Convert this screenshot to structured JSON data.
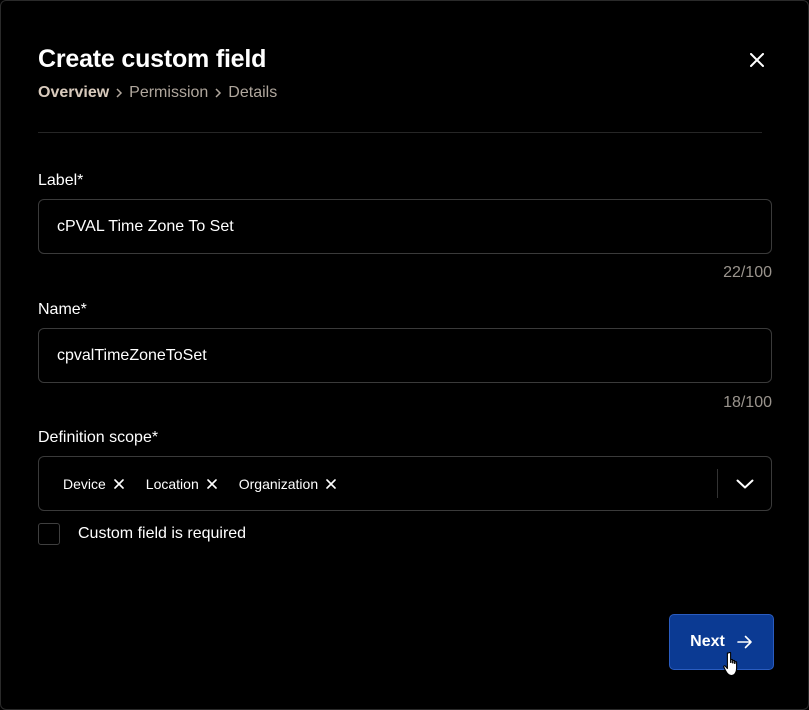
{
  "dialog": {
    "title": "Create custom field",
    "close_icon": "close-icon"
  },
  "breadcrumb": {
    "steps": [
      {
        "label": "Overview",
        "active": true
      },
      {
        "label": "Permission",
        "active": false
      },
      {
        "label": "Details",
        "active": false
      }
    ],
    "separator_icon": "chevron-right-icon"
  },
  "fields": {
    "label": {
      "title": "Label*",
      "value": "cPVAL Time Zone To Set",
      "counter": "22/100"
    },
    "name": {
      "title": "Name*",
      "value": "cpvalTimeZoneToSet",
      "counter": "18/100"
    },
    "definition_scope": {
      "title": "Definition scope*",
      "chips": [
        "Device",
        "Location",
        "Organization"
      ],
      "remove_icon": "x-icon",
      "dropdown_icon": "chevron-down-icon"
    }
  },
  "required_checkbox": {
    "label": "Custom field is required",
    "checked": false
  },
  "footer": {
    "next_label": "Next",
    "next_icon": "arrow-right-icon"
  },
  "colors": {
    "background": "#000000",
    "primary_button": "#0b3a93",
    "breadcrumb_active": "#d9cbbd",
    "breadcrumb_inactive": "#b0a79d",
    "counter_text": "#9a948d",
    "input_border": "#3a3a3a"
  }
}
